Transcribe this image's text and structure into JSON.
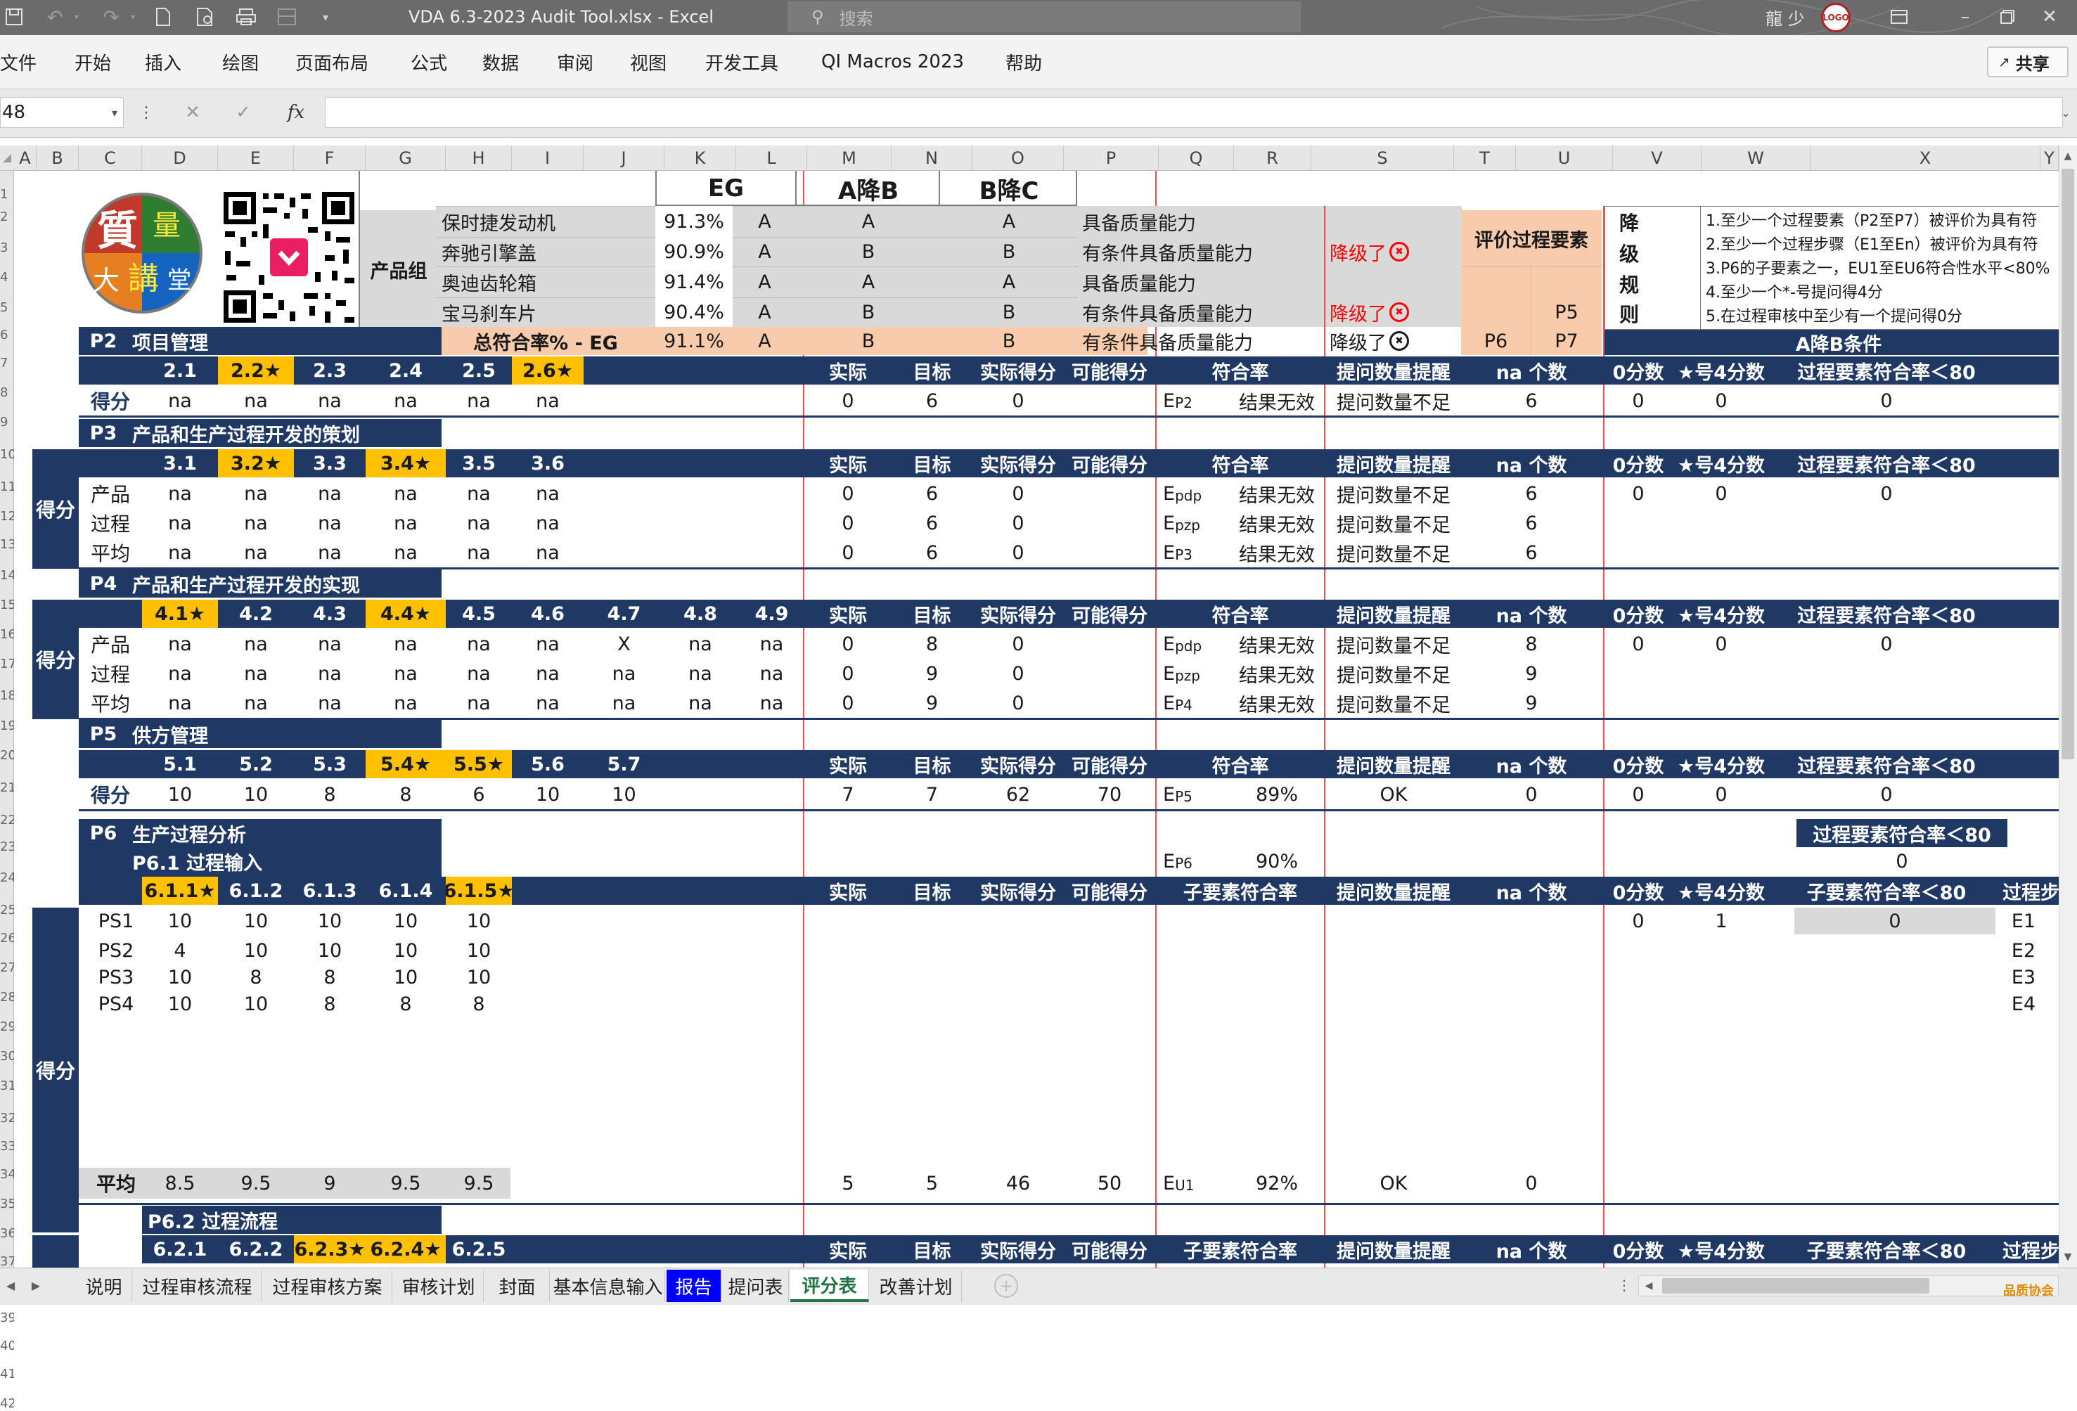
{
  "titlebar": {
    "save_icon": "save-icon",
    "file_title": "VDA 6.3-2023 Audit Tool.xlsx  -  Excel",
    "search_placeholder": "搜索",
    "user_name": "龍 少",
    "user_avatar": "avatar"
  },
  "ribbon": {
    "tabs": [
      "文件",
      "开始",
      "插入",
      "绘图",
      "页面布局",
      "公式",
      "数据",
      "审阅",
      "视图",
      "开发工具",
      "QI Macros 2023",
      "帮助"
    ],
    "share": "共享"
  },
  "formula_bar": {
    "name_box": "48",
    "fx": "fx",
    "value": ""
  },
  "columns": [
    "A",
    "B",
    "C",
    "D",
    "E",
    "F",
    "G",
    "H",
    "I",
    "J",
    "K",
    "L",
    "M",
    "N",
    "O",
    "P",
    "Q",
    "R",
    "S",
    "T",
    "U",
    "V",
    "W",
    "X",
    "Y"
  ],
  "rows": [
    "",
    "1",
    "2",
    "3",
    "4",
    "5",
    "6",
    "7",
    "8",
    "9",
    "10",
    "11",
    "12",
    "13",
    "14",
    "15",
    "16",
    "17",
    "18",
    "19",
    "20",
    "21",
    "22",
    "23",
    "24",
    "25",
    "26",
    "27",
    "28",
    "29",
    "30",
    "31",
    "32",
    "33",
    "34",
    "35",
    "36",
    "37",
    "38",
    "39",
    "40",
    "41",
    "42"
  ],
  "summary": {
    "heads": [
      "EG",
      "A降B",
      "B降C"
    ],
    "product_group": "产品组",
    "products": [
      {
        "name": "保时捷发动机",
        "pct": "91.3%",
        "eg": "A",
        "ab": "A",
        "bc": "A",
        "cap": "具备质量能力",
        "down": ""
      },
      {
        "name": "奔驰引擎盖",
        "pct": "90.9%",
        "eg": "A",
        "ab": "B",
        "bc": "B",
        "cap": "有条件具备质量能力",
        "down": "降级了"
      },
      {
        "name": "奥迪齿轮箱",
        "pct": "91.4%",
        "eg": "A",
        "ab": "A",
        "bc": "A",
        "cap": "具备质量能力",
        "down": ""
      },
      {
        "name": "宝马刹车片",
        "pct": "90.4%",
        "eg": "A",
        "ab": "B",
        "bc": "B",
        "cap": "有条件具备质量能力",
        "down": "降级了"
      }
    ],
    "total": {
      "label": "总符合率% - EG",
      "pct": "91.1%",
      "eg": "A",
      "ab": "B",
      "bc": "B",
      "cap": "有条件具备质量能力",
      "down": "降级了"
    },
    "eval_label": "评价过程要素",
    "eval_cells": [
      "P5",
      "P6",
      "P7"
    ],
    "rule_label": [
      "降",
      "级",
      "规",
      "则"
    ],
    "rules": [
      "1.至少一个过程要素（P2至P7）被评价为具有符",
      "2.至少一个过程步骤（E1至En）被评价为具有符",
      "3.P6的子要素之一，EU1至EU6符合性水平<80%",
      "4.至少一个*-号提问得4分",
      "5.在过程审核中至少有一个提问得0分"
    ],
    "ab_condition": "A降B条件"
  },
  "hdr": {
    "actual": "实际",
    "target": "目标",
    "actual_score": "实际得分",
    "possible": "可能得分",
    "rate": "符合率",
    "sub_rate": "子要素符合率",
    "reminder": "提问数量提醒",
    "na": "na 个数",
    "zero": "0分数",
    "star4": "★号4分数",
    "pe80": "过程要素符合率＜80",
    "se80": "子要素符合率＜80",
    "ps": "过程步"
  },
  "common": {
    "score": "得分",
    "product": "产品",
    "process": "过程",
    "average": "平均",
    "invalid": "结果无效",
    "insufficient": "提问数量不足",
    "ok": "OK"
  },
  "p2": {
    "code": "P2",
    "title": "项目管理",
    "items": [
      "2.1",
      "2.2★",
      "2.3",
      "2.4",
      "2.5",
      "2.6★"
    ],
    "values": [
      "na",
      "na",
      "na",
      "na",
      "na",
      "na"
    ],
    "actual": "0",
    "target": "6",
    "actual_score": "0",
    "e": "EP2",
    "na": "6",
    "zero": "0",
    "star4": "0",
    "pe80": "0"
  },
  "p3": {
    "code": "P3",
    "title": "产品和生产过程开发的策划",
    "items": [
      "3.1",
      "3.2★",
      "3.3",
      "3.4★",
      "3.5",
      "3.6"
    ],
    "rows": [
      {
        "lab": "产品",
        "v": [
          "na",
          "na",
          "na",
          "na",
          "na",
          "na"
        ],
        "actual": "0",
        "target": "6",
        "actual_score": "0",
        "e": "Epdp",
        "na": "6"
      },
      {
        "lab": "过程",
        "v": [
          "na",
          "na",
          "na",
          "na",
          "na",
          "na"
        ],
        "actual": "0",
        "target": "6",
        "actual_score": "0",
        "e": "Epzp",
        "na": "6"
      },
      {
        "lab": "平均",
        "v": [
          "na",
          "na",
          "na",
          "na",
          "na",
          "na"
        ],
        "actual": "0",
        "target": "6",
        "actual_score": "0",
        "e": "EP3",
        "na": "6"
      }
    ],
    "zero": "0",
    "star4": "0",
    "pe80": "0"
  },
  "p4": {
    "code": "P4",
    "title": "产品和生产过程开发的实现",
    "items": [
      "4.1★",
      "4.2",
      "4.3",
      "4.4★",
      "4.5",
      "4.6",
      "4.7",
      "4.8",
      "4.9"
    ],
    "rows": [
      {
        "lab": "产品",
        "v": [
          "na",
          "na",
          "na",
          "na",
          "na",
          "na",
          "X",
          "na",
          "na"
        ],
        "actual": "0",
        "target": "8",
        "actual_score": "0",
        "e": "Epdp",
        "na": "8"
      },
      {
        "lab": "过程",
        "v": [
          "na",
          "na",
          "na",
          "na",
          "na",
          "na",
          "na",
          "na",
          "na"
        ],
        "actual": "0",
        "target": "9",
        "actual_score": "0",
        "e": "Epzp",
        "na": "9"
      },
      {
        "lab": "平均",
        "v": [
          "na",
          "na",
          "na",
          "na",
          "na",
          "na",
          "na",
          "na",
          "na"
        ],
        "actual": "0",
        "target": "9",
        "actual_score": "0",
        "e": "EP4",
        "na": "9"
      }
    ],
    "zero": "0",
    "star4": "0",
    "pe80": "0"
  },
  "p5": {
    "code": "P5",
    "title": "供方管理",
    "items": [
      "5.1",
      "5.2",
      "5.3",
      "5.4★",
      "5.5★",
      "5.6",
      "5.7"
    ],
    "values": [
      "10",
      "10",
      "8",
      "8",
      "6",
      "10",
      "10"
    ],
    "actual": "7",
    "target": "7",
    "actual_score": "62",
    "possible": "70",
    "e": "EP5",
    "rate": "89%",
    "reminder": "OK",
    "na": "0",
    "zero": "0",
    "star4": "0",
    "pe80": "0"
  },
  "p6": {
    "code": "P6",
    "title": "生产过程分析",
    "e": "EP6",
    "rate": "90%",
    "pe80_label": "过程要素符合率＜80",
    "pe80": "0",
    "s1": {
      "title": "P6.1 过程输入",
      "items": [
        "6.1.1★",
        "6.1.2",
        "6.1.3",
        "6.1.4",
        "6.1.5★"
      ],
      "rows": [
        {
          "lab": "PS1",
          "v": [
            "10",
            "10",
            "10",
            "10",
            "10"
          ]
        },
        {
          "lab": "PS2",
          "v": [
            "4",
            "10",
            "10",
            "10",
            "10"
          ]
        },
        {
          "lab": "PS3",
          "v": [
            "10",
            "8",
            "8",
            "10",
            "10"
          ]
        },
        {
          "lab": "PS4",
          "v": [
            "10",
            "10",
            "8",
            "8",
            "8"
          ]
        }
      ],
      "avg": [
        "8.5",
        "9.5",
        "9",
        "9.5",
        "9.5"
      ],
      "actual": "5",
      "target": "5",
      "actual_score": "46",
      "possible": "50",
      "e": "EU1",
      "rate": "92%",
      "reminder": "OK",
      "na": "0",
      "zero": "0",
      "star4": "1",
      "se80": "0",
      "ps": [
        "E1",
        "E2",
        "E3",
        "E4"
      ]
    },
    "s2": {
      "title": "P6.2 过程流程",
      "items": [
        "6.2.1",
        "6.2.2",
        "6.2.3★",
        "6.2.4★",
        "6.2.5"
      ]
    }
  },
  "sheets": [
    "说明",
    "过程审核流程",
    "过程审核方案",
    "审核计划",
    "封面",
    "基本信息输入",
    "报告",
    "提问表",
    "评分表",
    "改善计划"
  ],
  "logo": {
    "text": [
      "質",
      "量",
      "大",
      "講",
      "堂"
    ]
  },
  "watermark": "品质协会",
  "colors": {
    "header_navy": "#203864",
    "highlight": "#ffc000",
    "salmon": "#f8cbad",
    "excel_green": "#217346"
  }
}
